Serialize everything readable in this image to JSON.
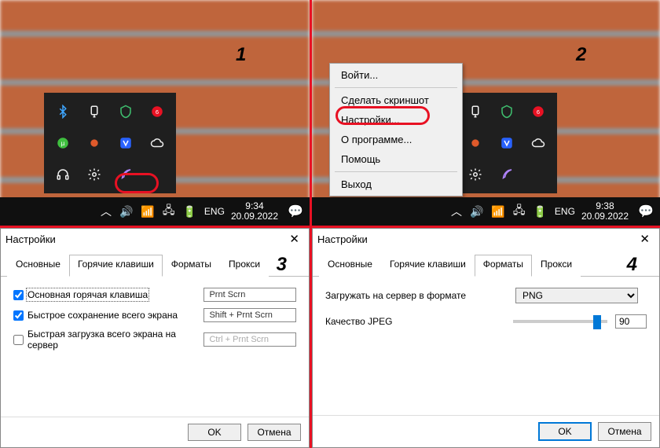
{
  "panels": {
    "n1": "1",
    "n2": "2",
    "n3": "3",
    "n4": "4"
  },
  "colors": {
    "accent_red": "#e81123",
    "accent_blue": "#0078d7"
  },
  "tray_icons": [
    "bluetooth-icon",
    "usb-icon",
    "security-icon",
    "antivirus-icon",
    "torrent-icon",
    "recorder-icon",
    "browser-icon",
    "cloud-icon",
    "headset-icon",
    "settings-icon",
    "app-feather-icon",
    ""
  ],
  "context_menu": {
    "login": "Войти...",
    "screenshot": "Сделать скриншот",
    "settings": "Настройки...",
    "about": "О программе...",
    "help": "Помощь",
    "exit": "Выход"
  },
  "taskbar1": {
    "lang": "ENG",
    "time": "9:34",
    "date": "20.09.2022"
  },
  "taskbar2": {
    "lang": "ENG",
    "time": "9:38",
    "date": "20.09.2022"
  },
  "taskbar_icons": [
    "chevron-up-icon",
    "volume-icon",
    "wifi-icon",
    "network-icon",
    "battery-icon"
  ],
  "dialog_title": "Настройки",
  "tabs": {
    "basic": "Основные",
    "hotkeys": "Горячие клавиши",
    "formats": "Форматы",
    "proxy": "Прокси"
  },
  "hotkeys": {
    "r1_label": "Основная горячая клавиша",
    "r1_value": "Prnt Scrn",
    "r1_checked": true,
    "r2_label": "Быстрое сохранение всего экрана",
    "r2_value": "Shift + Prnt Scrn",
    "r2_checked": true,
    "r3_label": "Быстрая загрузка всего экрана на сервер",
    "r3_value": "Ctrl + Prnt Scrn",
    "r3_checked": false
  },
  "formats": {
    "upload_label": "Загружать на сервер в формате",
    "upload_value": "PNG",
    "quality_label": "Качество JPEG",
    "quality_value": "90"
  },
  "buttons": {
    "ok": "OK",
    "cancel": "Отмена"
  }
}
